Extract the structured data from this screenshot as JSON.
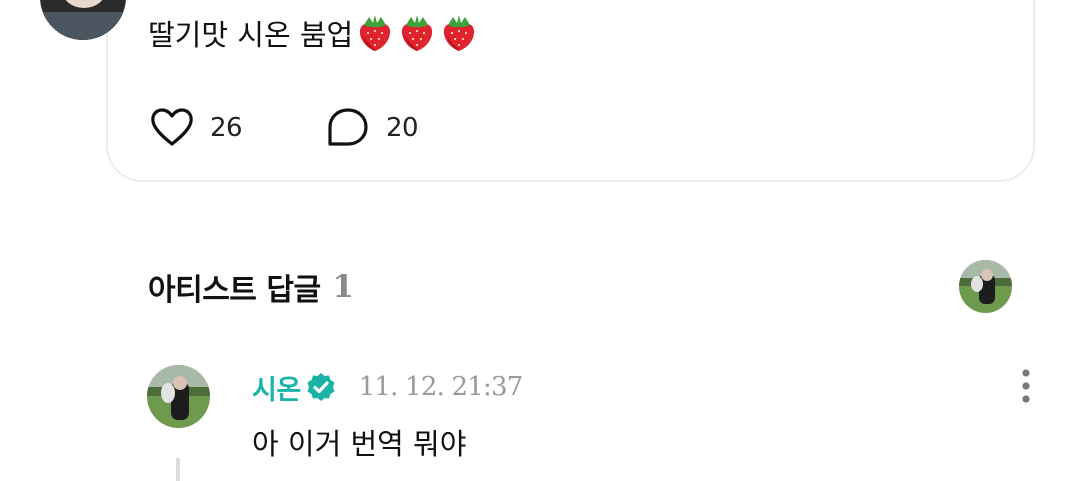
{
  "post": {
    "text": "딸기맛 시온 붐업",
    "emoji_count": 3,
    "emoji_icon": "strawberry-icon",
    "like_count": "26",
    "comment_count": "20",
    "like_icon": "heart-outline-icon",
    "comment_icon": "speech-bubble-icon"
  },
  "artist_replies": {
    "title": "아티스트 답글",
    "count": "1",
    "header_avatar": "artist-avatar"
  },
  "reply": {
    "author": "시온",
    "verified_icon": "verified-check-icon",
    "date": "11. 12. 21:37",
    "text": "아 이거 번역 뭐야",
    "more_icon": "more-vertical-icon"
  },
  "colors": {
    "accent_teal": "#1ab3a6",
    "muted_gray": "#9a9a9a",
    "count_gray": "#8a8a8a",
    "card_border": "#ececec",
    "text_dark": "#111111"
  }
}
